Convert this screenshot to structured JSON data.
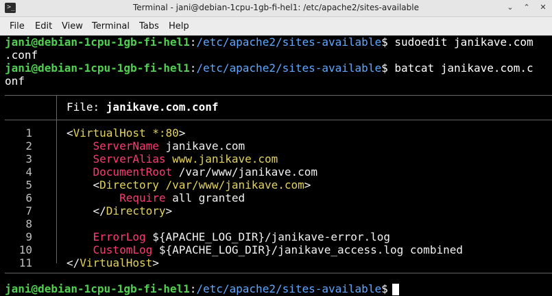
{
  "window": {
    "title": "Terminal - jani@debian-1cpu-1gb-fi-hel1: /etc/apache2/sites-available",
    "icon_name": "terminal-icon",
    "controls": [
      "minimize-icon",
      "maximize-icon",
      "close-icon"
    ]
  },
  "menu": [
    "File",
    "Edit",
    "View",
    "Terminal",
    "Tabs",
    "Help"
  ],
  "prompt": {
    "user_host": "jani@debian-1cpu-1gb-fi-hel1",
    "colon": ":",
    "path": "/etc/apache2/sites-available",
    "symbol": "$"
  },
  "commands": [
    {
      "first": " sudoedit janikave.com",
      "wrap": ".conf"
    },
    {
      "first": " batcat janikave.com.c",
      "wrap": "onf"
    }
  ],
  "bat": {
    "file_label": "File: ",
    "file_name": "janikave.com.conf",
    "line_numbers": [
      "1",
      "2",
      "3",
      "4",
      "5",
      "6",
      "7",
      "8",
      "9",
      "10",
      "11"
    ],
    "lines": {
      "l1": {
        "open": "<",
        "tag": "VirtualHost",
        "arg": " *:80",
        "close": ">"
      },
      "l2": {
        "indent": "    ",
        "directive": "ServerName",
        "value": " janikave.com"
      },
      "l3": {
        "indent": "    ",
        "directive": "ServerAlias",
        "value": " www.janikave.com"
      },
      "l4": {
        "indent": "    ",
        "directive": "DocumentRoot",
        "value": " /var/www/janikave.com"
      },
      "l5": {
        "indent": "    ",
        "open": "<",
        "tag": "Directory",
        "arg": " /var/www/janikave.com",
        "close": ">"
      },
      "l6": {
        "indent": "        ",
        "directive": "Require",
        "value": " all granted"
      },
      "l7": {
        "indent": "    ",
        "open": "</",
        "tag": "Directory",
        "close": ">"
      },
      "l9": {
        "indent": "    ",
        "directive": "ErrorLog",
        "value": " ${APACHE_LOG_DIR}/janikave-error.log"
      },
      "l10": {
        "indent": "    ",
        "directive": "CustomLog",
        "value": " ${APACHE_LOG_DIR}/janikave_access.log combined"
      },
      "l11": {
        "open": "</",
        "tag": "VirtualHost",
        "close": ">"
      }
    }
  },
  "colors": {
    "prompt_user": "#4fd14f",
    "prompt_path": "#5fa8ff",
    "directive": "#ff3b73",
    "tag_args": "#e5d35a",
    "background": "#000000"
  }
}
